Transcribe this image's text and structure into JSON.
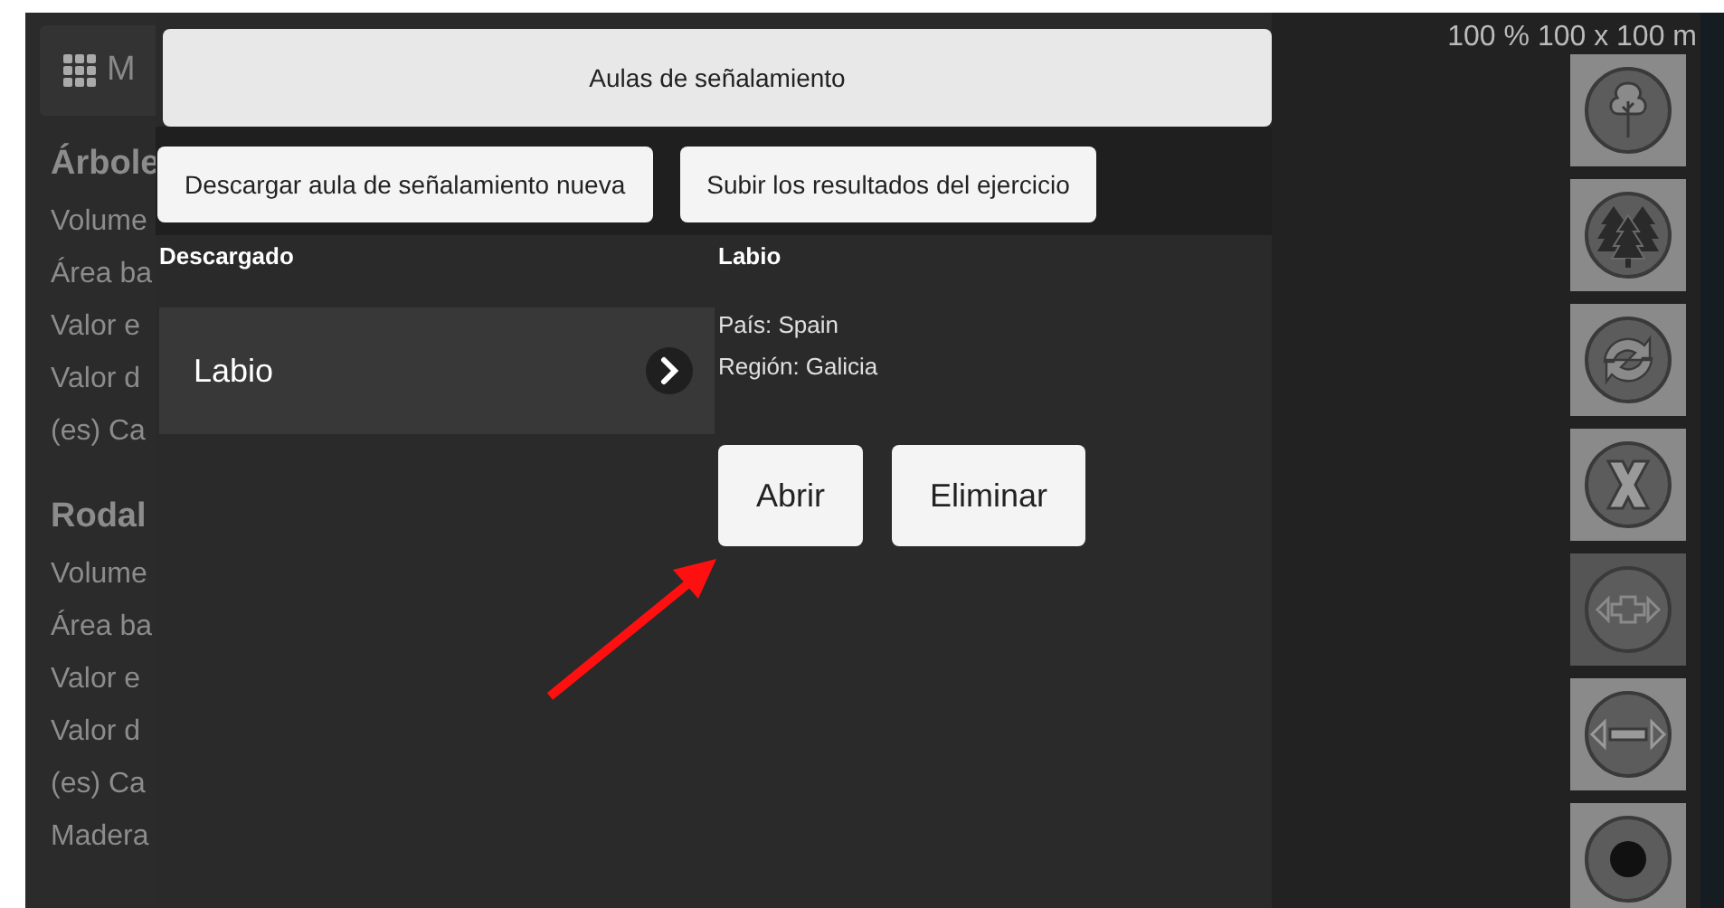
{
  "app_header": {
    "label": "M"
  },
  "background_sections": [
    {
      "title": "Árbole",
      "lines": [
        "Volume",
        "Área ba",
        "Valor e",
        "Valor d",
        "(es) Ca"
      ]
    },
    {
      "title": "Rodal",
      "lines": [
        "Volume",
        "Área ba",
        "Valor e",
        "Valor d",
        "(es) Ca",
        "Madera"
      ]
    }
  ],
  "dialog": {
    "title": "Aulas de señalamiento",
    "actions": [
      "Descargar aula de señalamiento nueva",
      "Subir los resultados del ejercicio"
    ],
    "list_heading": "Descargado",
    "items": [
      {
        "name": "Labio",
        "selected": true
      }
    ],
    "detail": {
      "title": "Labio",
      "lines": [
        "País: Spain",
        "Región: Galicia"
      ],
      "buttons": [
        "Abrir",
        "Eliminar"
      ]
    }
  },
  "scale_label": "100 % 100 x 100 m",
  "tools": [
    {
      "kind": "tree",
      "disabled": false
    },
    {
      "kind": "forest",
      "disabled": false
    },
    {
      "kind": "refresh",
      "disabled": false
    },
    {
      "kind": "close",
      "disabled": false
    },
    {
      "kind": "expand",
      "disabled": true
    },
    {
      "kind": "shrink",
      "disabled": false
    },
    {
      "kind": "partial",
      "disabled": false
    }
  ]
}
